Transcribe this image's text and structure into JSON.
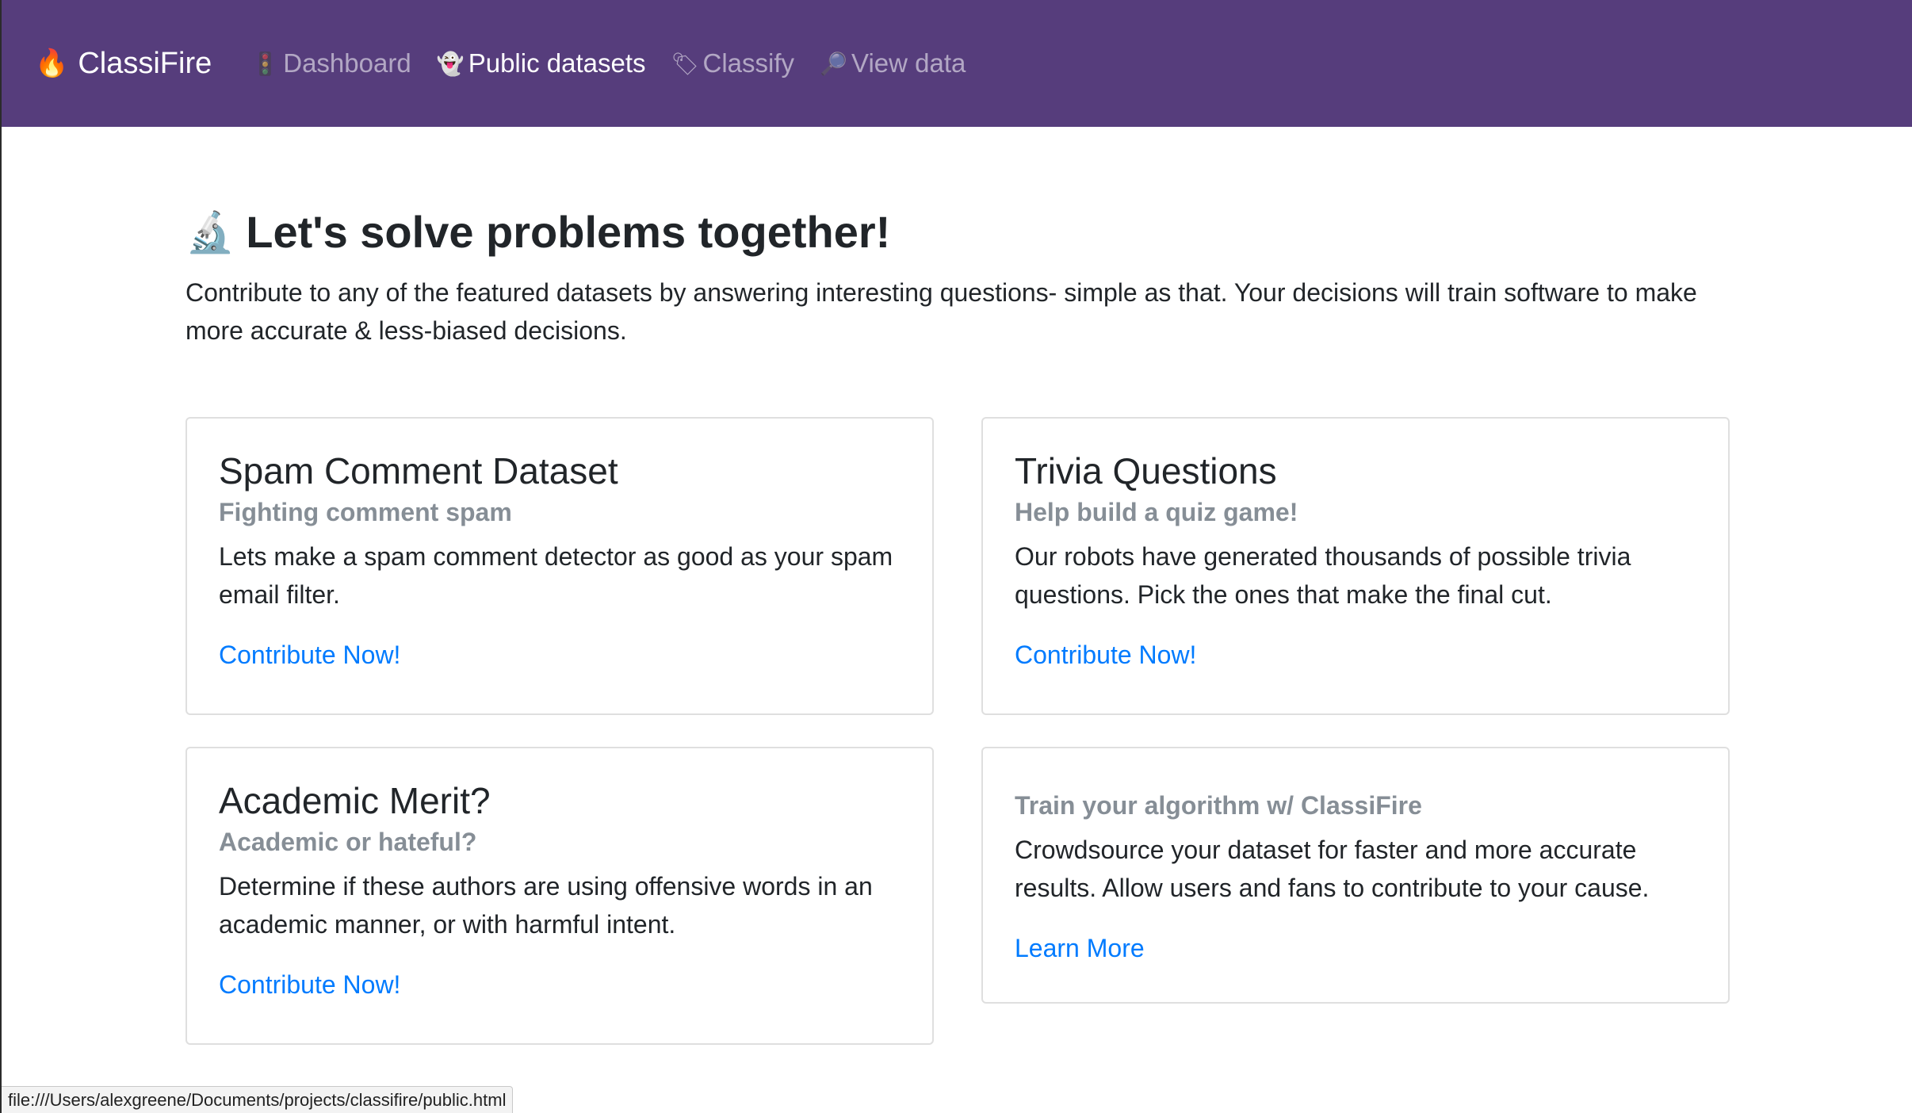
{
  "navbar": {
    "brand_icon": "🔥",
    "brand": "ClassiFire",
    "items": [
      {
        "icon": "🚦",
        "icon_name": "traffic-light-icon",
        "label": "Dashboard",
        "active": false
      },
      {
        "icon": "👻",
        "icon_name": "ghost-icon",
        "label": "Public datasets",
        "active": true
      },
      {
        "icon": "🏷",
        "icon_name": "tag-icon",
        "label": "Classify",
        "active": false
      },
      {
        "icon": "🔎",
        "icon_name": "magnifier-icon",
        "label": "View data",
        "active": false
      }
    ]
  },
  "hero": {
    "icon": "🔬",
    "title": "Let's solve problems together!",
    "lead": "Contribute to any of the featured datasets by answering interesting questions- simple as that. Your decisions will train software to make more accurate & less-biased decisions."
  },
  "cards": [
    {
      "title": "Spam Comment Dataset",
      "subtitle": "Fighting comment spam",
      "text": "Lets make a spam comment detector as good as your spam email filter.",
      "link": "Contribute Now!"
    },
    {
      "title": "Trivia Questions",
      "subtitle": "Help build a quiz game!",
      "text": "Our robots have generated thousands of possible trivia questions. Pick the ones that make the final cut.",
      "link": "Contribute Now!"
    },
    {
      "title": "Academic Merit?",
      "subtitle": "Academic or hateful?",
      "text": "Determine if these authors are using offensive words in an academic manner, or with harmful intent.",
      "link": "Contribute Now!"
    },
    {
      "subtitle": "Train your algorithm w/ ClassiFire",
      "text": "Crowdsource your dataset for faster and more accurate results. Allow users and fans to contribute to your cause.",
      "link": "Learn More"
    }
  ],
  "status_bar": {
    "url": "file:///Users/alexgreene/Documents/projects/classifire/public.html"
  },
  "colors": {
    "navbar_bg": "#563d7c",
    "link": "#007bff",
    "muted": "#868e96",
    "text": "#212529"
  }
}
